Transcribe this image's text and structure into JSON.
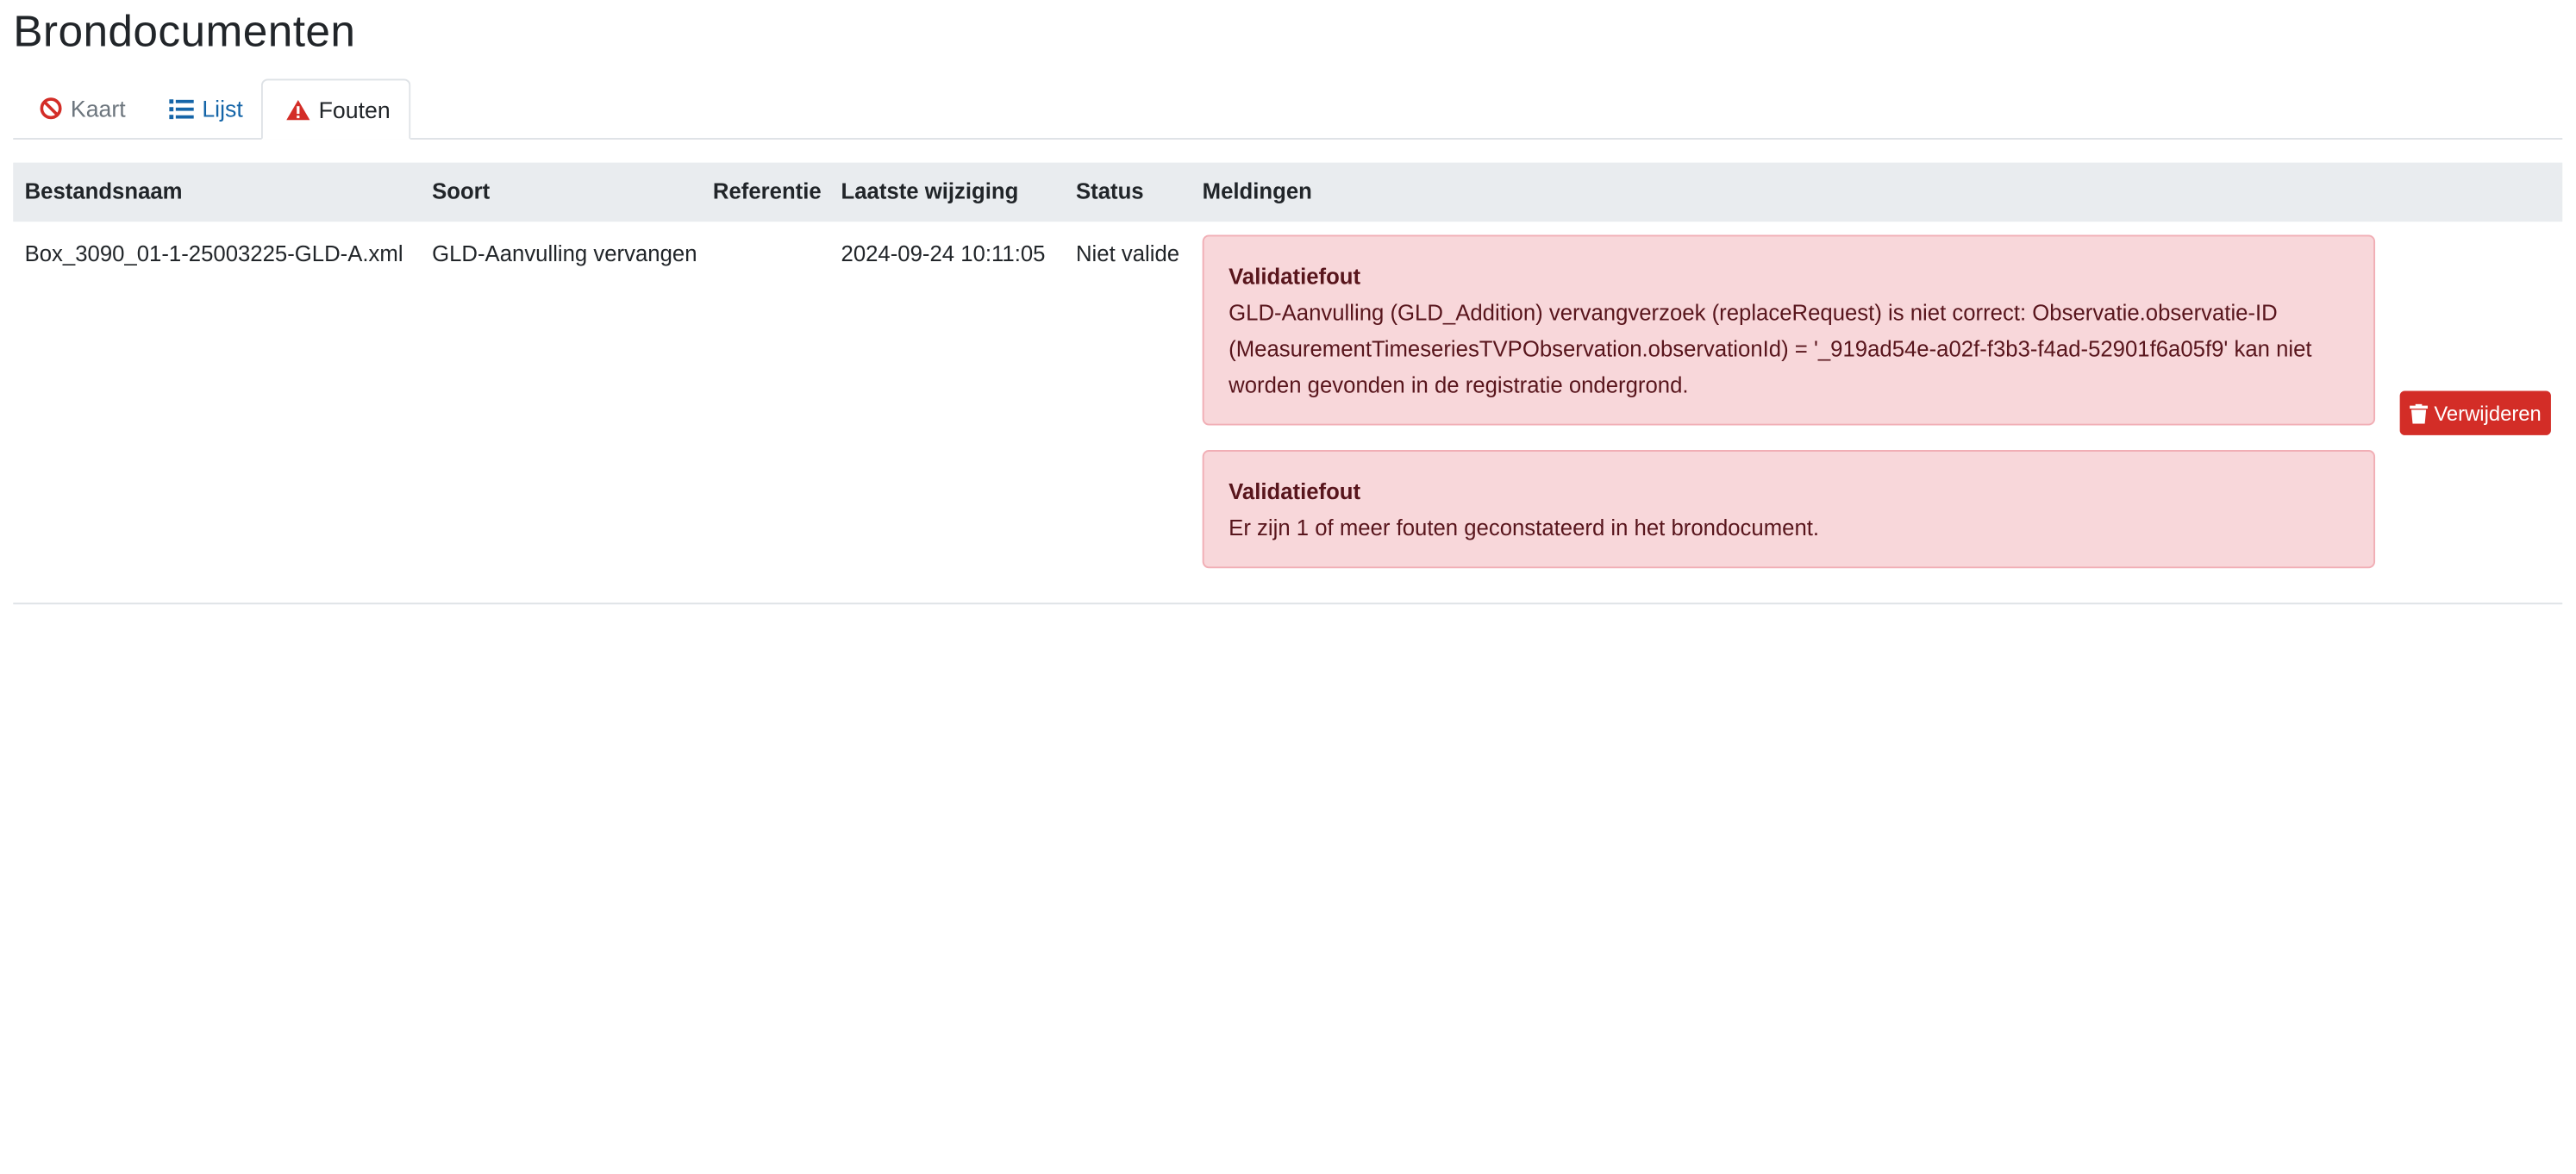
{
  "page": {
    "title": "Brondocumenten"
  },
  "tabs": [
    {
      "label": "Kaart",
      "icon": "ban-icon",
      "active": false
    },
    {
      "label": "Lijst",
      "icon": "list-icon",
      "active": false
    },
    {
      "label": "Fouten",
      "icon": "warning-icon",
      "active": true
    }
  ],
  "table": {
    "headers": [
      "Bestandsnaam",
      "Soort",
      "Referentie",
      "Laatste wijziging",
      "Status",
      "Meldingen"
    ],
    "rows": [
      {
        "bestandsnaam": "Box_3090_01-1-25003225-GLD-A.xml",
        "soort": "GLD-Aanvulling vervangen",
        "referentie": "",
        "laatste_wijziging": "2024-09-24 10:11:05",
        "status": "Niet valide",
        "meldingen": [
          {
            "title": "Validatiefout",
            "message": "GLD-Aanvulling (GLD_Addition) vervangverzoek (replaceRequest) is niet correct: Observatie.observatie-ID (MeasurementTimeseriesTVPObservation.observationId) = '_919ad54e-a02f-f3b3-f4ad-52901f6a05f9' kan niet worden gevonden in de registratie ondergrond."
          },
          {
            "title": "Validatiefout",
            "message": "Er zijn 1 of meer fouten geconstateerd in het brondocument."
          }
        ],
        "delete_label": "Verwijderen"
      }
    ]
  },
  "colors": {
    "link": "#1565a8",
    "danger": "#d32d27",
    "alert_bg": "#f8d7da",
    "alert_text": "#58151c",
    "header_bg": "#e9ecef"
  }
}
